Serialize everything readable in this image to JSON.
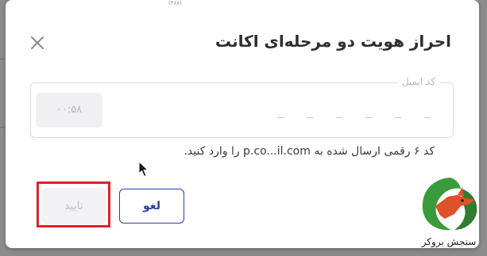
{
  "dialog": {
    "title": "احراز هویت دو مرحله‌ای اکانت",
    "top_peek_text": "(۳۸۸)"
  },
  "code_field": {
    "legend": "کد ایمیل",
    "placeholder": "_ _ _ _ _ _",
    "timer": "۰۰:۵۸"
  },
  "instruction": "کد ۶ رقمی ارسال شده به p.co...il.com را وارد کنید.",
  "buttons": {
    "cancel_label": "لغو",
    "confirm_label": "تایید"
  },
  "watermark": {
    "text": "سنجش بروکر"
  },
  "colors": {
    "primary": "#2d3e9a",
    "highlight": "#e0202a",
    "logo_green": "#3a9b3a",
    "logo_orange": "#e0502a"
  }
}
